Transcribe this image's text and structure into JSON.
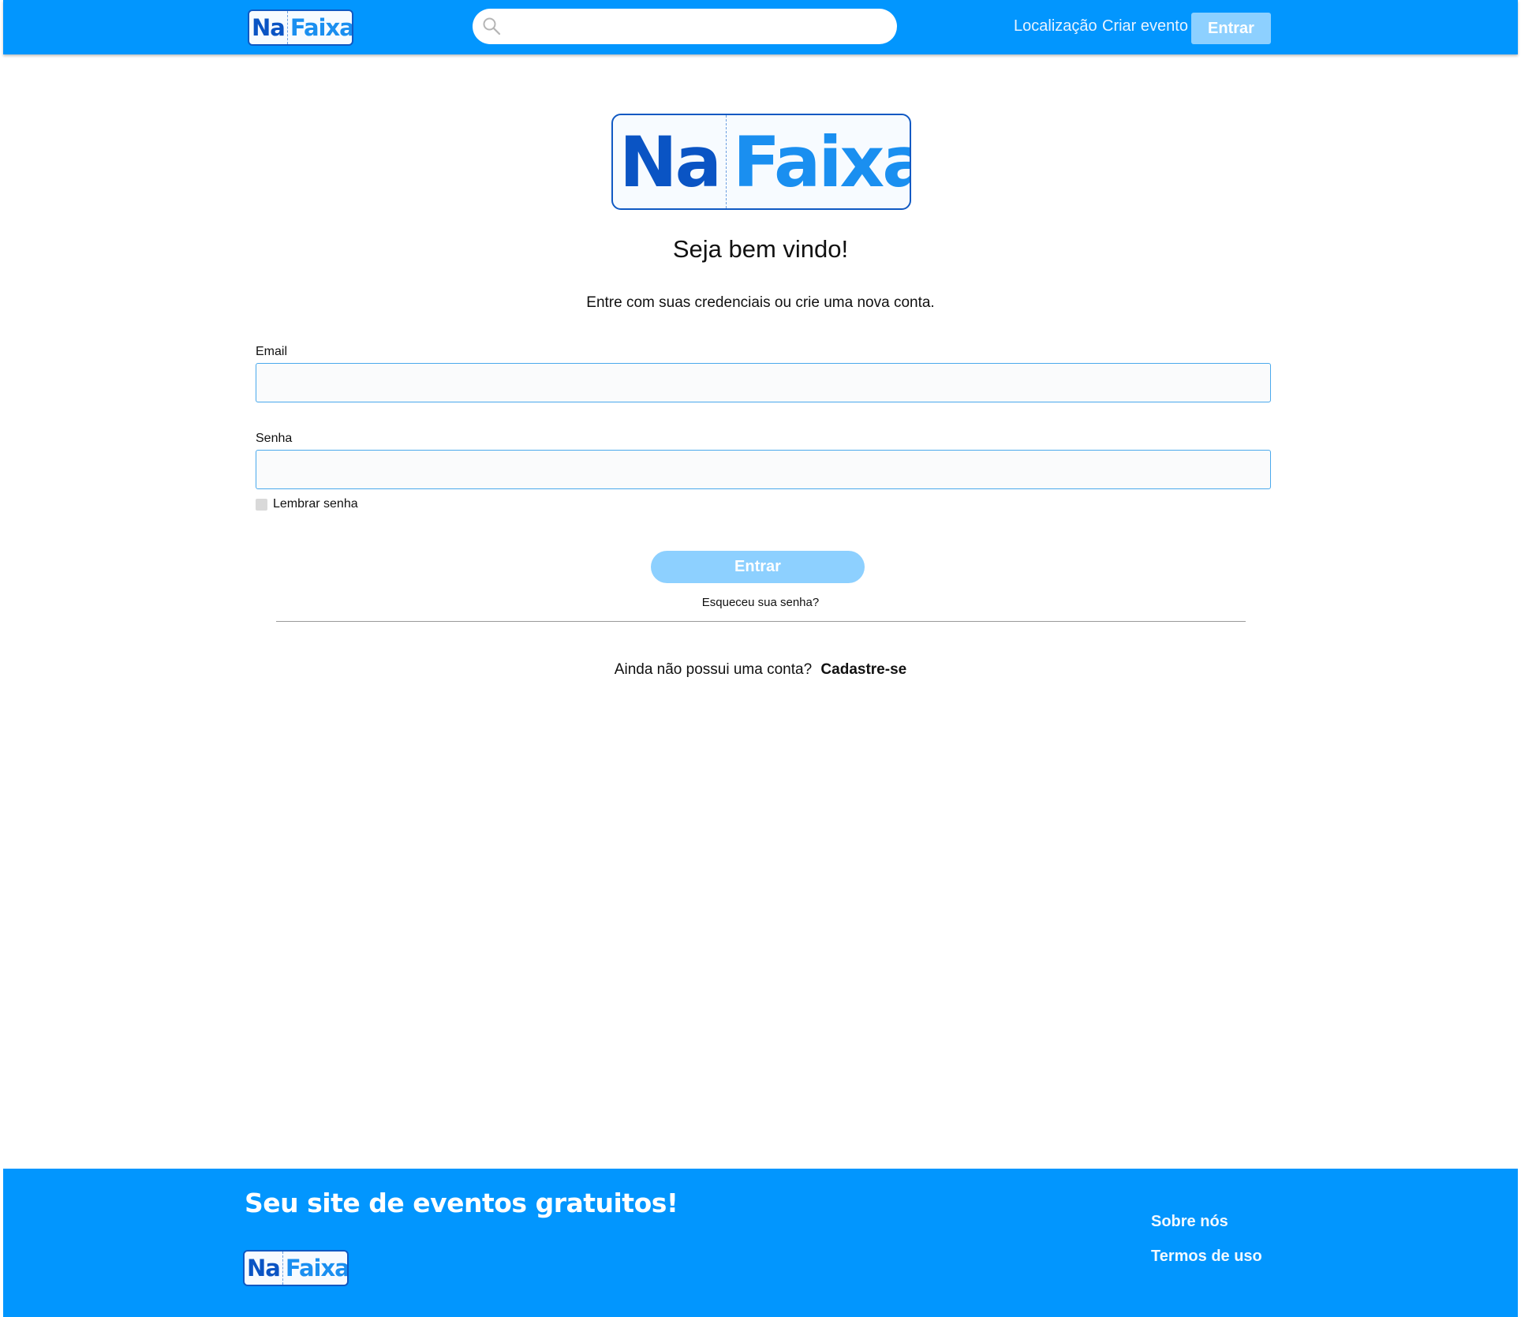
{
  "brand": {
    "name_part1": "Na",
    "name_part2": "Faixa",
    "primary_color": "#0296fe",
    "light_button_color": "#8dd0ff",
    "logo_dark_blue": "#0a54c4"
  },
  "header": {
    "search": {
      "icon": "search-icon",
      "value": "",
      "placeholder": ""
    },
    "nav": {
      "location": "Localização",
      "create_event": "Criar evento",
      "login": "Entrar"
    }
  },
  "main": {
    "welcome": "Seja bem vindo!",
    "subtitle": "Entre com suas credenciais ou  crie uma nova conta.",
    "email_label": "Email",
    "email_value": "",
    "password_label": "Senha",
    "password_value": "",
    "remember_label": "Lembrar senha",
    "remember_checked": false,
    "login_button": "Entrar",
    "forgot_password": "Esqueceu sua senha?",
    "no_account": "Ainda não possui uma conta?",
    "signup": "Cadastre-se"
  },
  "footer": {
    "tagline": "Seu site de eventos gratuitos!",
    "about": "Sobre nós",
    "terms": "Termos de uso"
  }
}
